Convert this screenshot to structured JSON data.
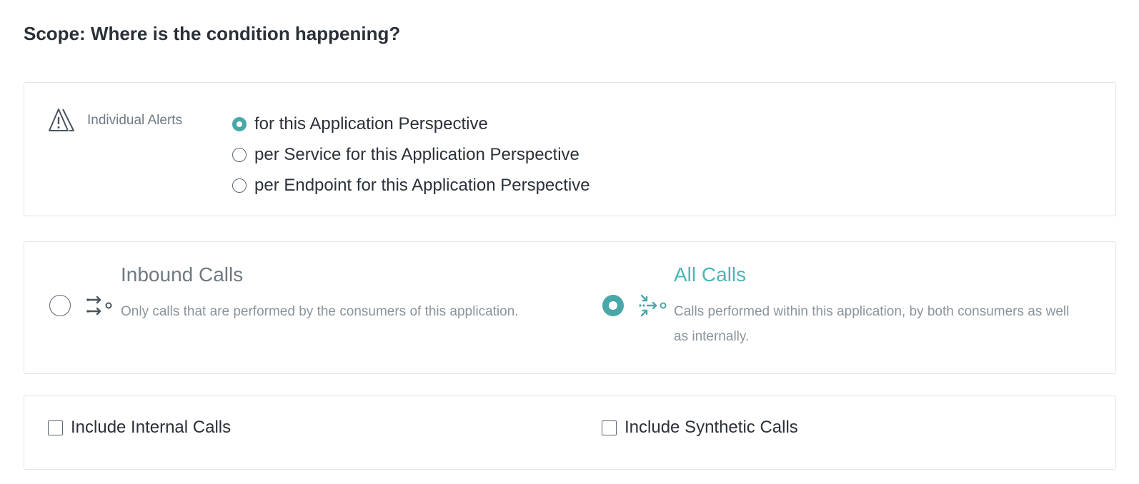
{
  "scope": {
    "title": "Scope: Where is the condition happening?"
  },
  "alerts": {
    "icon": "warning-triangles-icon",
    "label": "Individual Alerts",
    "options": [
      {
        "label": "for this Application Perspective",
        "selected": true
      },
      {
        "label": "per Service for this Application Perspective",
        "selected": false
      },
      {
        "label": "per Endpoint for this Application Perspective",
        "selected": false
      }
    ]
  },
  "calls": {
    "accent_color": "#4bb6b6",
    "options": [
      {
        "icon": "inbound-calls-icon",
        "title": "Inbound Calls",
        "description": "Only calls that are performed by the consumers of this application.",
        "selected": false
      },
      {
        "icon": "all-calls-icon",
        "title": "All Calls",
        "description": "Calls performed within this application, by both consumers as well as internally.",
        "selected": true
      }
    ]
  },
  "include": {
    "internal_label": "Include Internal Calls",
    "internal_checked": false,
    "synthetic_label": "Include Synthetic Calls",
    "synthetic_checked": false
  }
}
